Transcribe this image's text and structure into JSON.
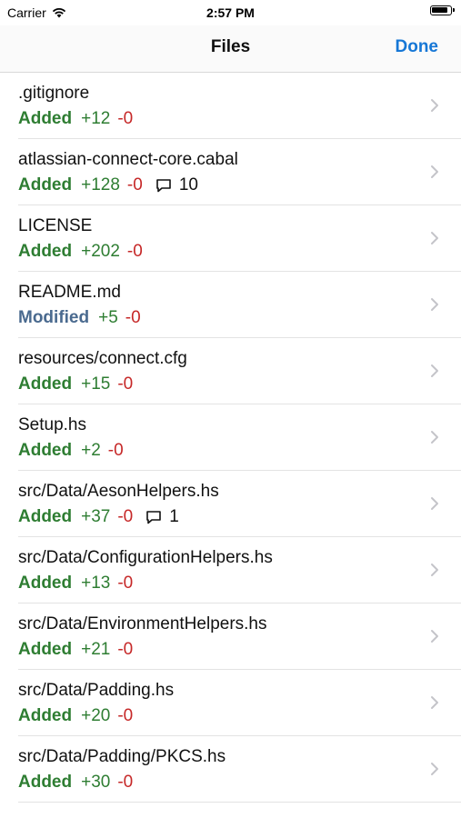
{
  "status_bar": {
    "carrier": "Carrier",
    "time": "2:57 PM"
  },
  "nav": {
    "title": "Files",
    "done_label": "Done"
  },
  "files": [
    {
      "name": ".gitignore",
      "status": "Added",
      "additions": "+12",
      "deletions": "-0",
      "comments": ""
    },
    {
      "name": "atlassian-connect-core.cabal",
      "status": "Added",
      "additions": "+128",
      "deletions": "-0",
      "comments": "10"
    },
    {
      "name": "LICENSE",
      "status": "Added",
      "additions": "+202",
      "deletions": "-0",
      "comments": ""
    },
    {
      "name": "README.md",
      "status": "Modified",
      "additions": "+5",
      "deletions": "-0",
      "comments": ""
    },
    {
      "name": "resources/connect.cfg",
      "status": "Added",
      "additions": "+15",
      "deletions": "-0",
      "comments": ""
    },
    {
      "name": "Setup.hs",
      "status": "Added",
      "additions": "+2",
      "deletions": "-0",
      "comments": ""
    },
    {
      "name": "src/Data/AesonHelpers.hs",
      "status": "Added",
      "additions": "+37",
      "deletions": "-0",
      "comments": "1"
    },
    {
      "name": "src/Data/ConfigurationHelpers.hs",
      "status": "Added",
      "additions": "+13",
      "deletions": "-0",
      "comments": ""
    },
    {
      "name": "src/Data/EnvironmentHelpers.hs",
      "status": "Added",
      "additions": "+21",
      "deletions": "-0",
      "comments": ""
    },
    {
      "name": "src/Data/Padding.hs",
      "status": "Added",
      "additions": "+20",
      "deletions": "-0",
      "comments": ""
    },
    {
      "name": "src/Data/Padding/PKCS.hs",
      "status": "Added",
      "additions": "+30",
      "deletions": "-0",
      "comments": ""
    }
  ],
  "colors": {
    "added": "#2e7d32",
    "modified": "#4a6a8f",
    "deletions": "#c62828",
    "accent": "#1677d6"
  }
}
